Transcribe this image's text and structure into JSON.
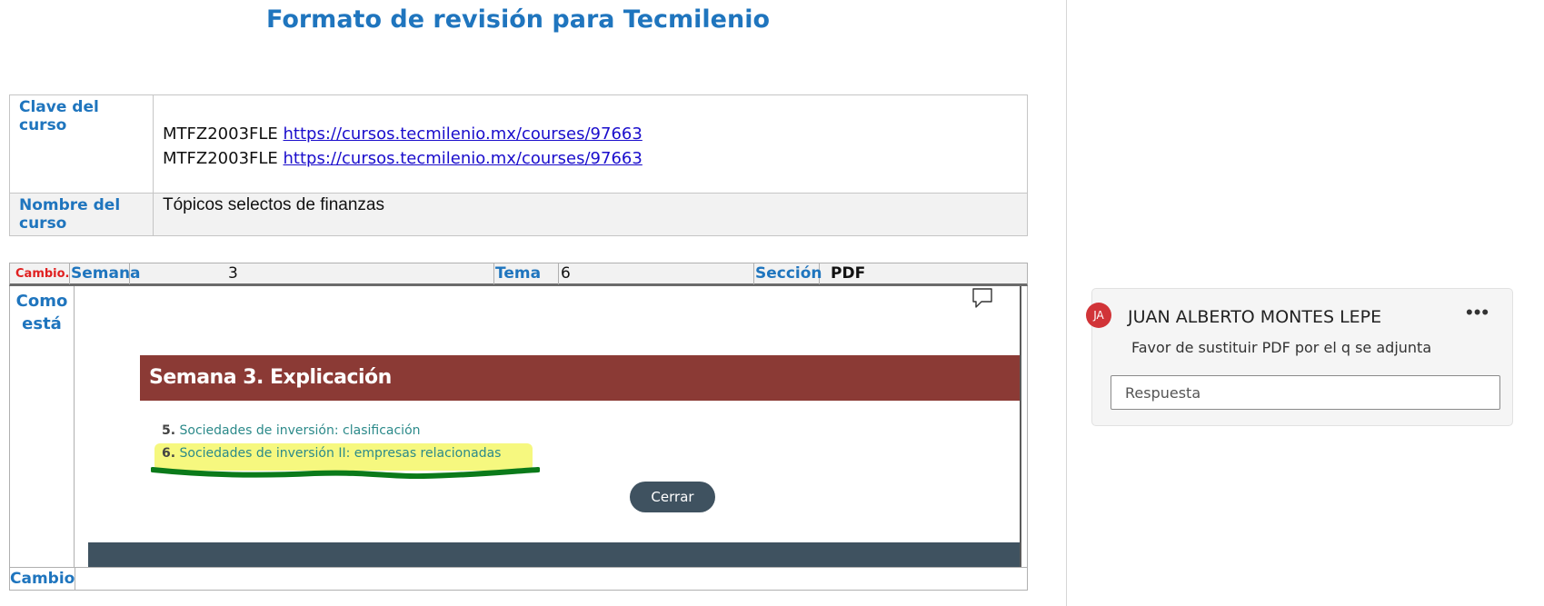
{
  "document": {
    "title": "Formato de revisión para Tecmilenio",
    "course_info": {
      "code_label": "Clave del curso",
      "code_lines": [
        {
          "code": "MTFZ2003FLE",
          "url": "https://cursos.tecmilenio.mx/courses/97663"
        },
        {
          "code": "MTFZ2003FLE",
          "url": "https://cursos.tecmilenio.mx/courses/97663"
        }
      ],
      "name_label": "Nombre del curso",
      "name_value": "Tópicos selectos de finanzas"
    },
    "review_table": {
      "change_tag": "Cambio.",
      "week_label": "Semana",
      "week_value": "3",
      "topic_label": "Tema",
      "topic_value": "6",
      "section_label": "Sección",
      "section_value": "PDF",
      "current_label": "Como está",
      "change_label": "Cambio"
    },
    "embedded_screenshot": {
      "banner_title": "Semana 3. Explicación",
      "items": [
        {
          "number": "5.",
          "text": "Sociedades de inversión: clasificación",
          "highlighted": false
        },
        {
          "number": "6.",
          "text": "Sociedades de inversión II: empresas relacionadas",
          "highlighted": true
        }
      ],
      "close_button": "Cerrar",
      "highlight_color": "#f5f768",
      "underline_color": "#0b7a1a"
    }
  },
  "comment_pane": {
    "avatar_initials": "JA",
    "author": "JUAN ALBERTO MONTES LEPE",
    "more_label": "•••",
    "comment_text": "Favor de sustituir PDF por el q se adjunta",
    "reply_placeholder": "Respuesta",
    "avatar_color": "#d13438"
  },
  "colors": {
    "accent_blue": "#1f75be",
    "link_blue": "#1a0dcc",
    "change_red": "#e02020",
    "banner_red": "#8b3a35",
    "dark_slate": "#3f5260"
  }
}
